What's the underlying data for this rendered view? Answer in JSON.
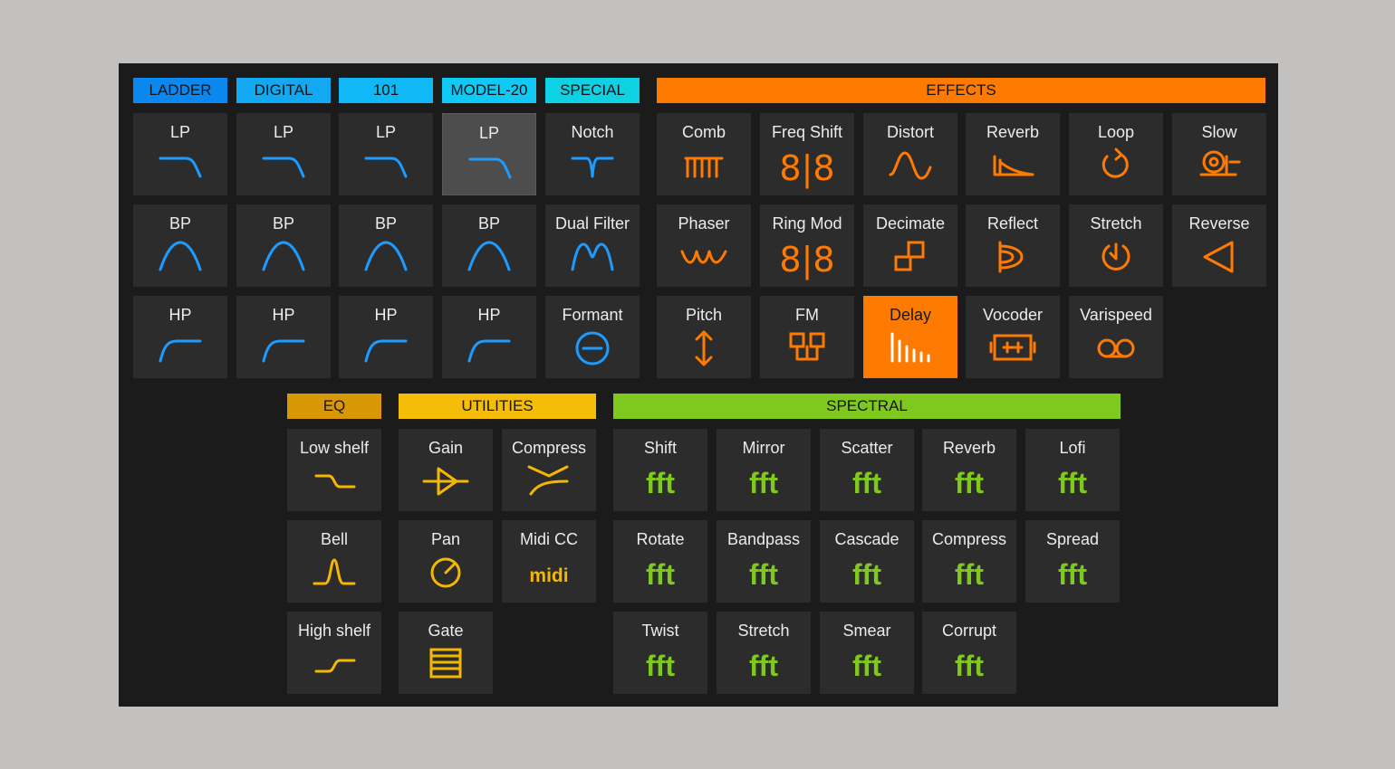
{
  "colors": {
    "panel": "#1b1b1b",
    "tile": "#2c2c2c",
    "tile_selected": "#4d4d4d",
    "tile_active": "#ff7a00",
    "blue_icon": "#1e9bff",
    "orange_icon": "#ff7a00",
    "yellow_icon": "#f5b800",
    "green_icon": "#7fc81e",
    "ladder": "#0a88f0",
    "digital": "#12a8f2",
    "model101": "#10b9f5",
    "model20": "#11c9f5",
    "special": "#0ed2e3",
    "effects": "#ff7a00",
    "eq": "#d89806",
    "utilities": "#f5bd07",
    "spectral": "#7fc81e"
  },
  "headers": {
    "ladder": "LADDER",
    "digital": "DIGITAL",
    "m101": "101",
    "model20": "MODEL-20",
    "special": "SPECIAL",
    "effects": "EFFECTS",
    "eq": "EQ",
    "utilities": "UTILITIES",
    "spectral": "SPECTRAL"
  },
  "filters": [
    {
      "label": "LP",
      "icon": "lowpass-filter-icon"
    },
    {
      "label": "LP",
      "icon": "lowpass-filter-icon"
    },
    {
      "label": "LP",
      "icon": "lowpass-filter-icon"
    },
    {
      "label": "LP",
      "icon": "lowpass-filter-icon",
      "selected": true
    },
    {
      "label": "Notch",
      "icon": "notch-filter-icon"
    },
    {
      "label": "BP",
      "icon": "bandpass-filter-icon"
    },
    {
      "label": "BP",
      "icon": "bandpass-filter-icon"
    },
    {
      "label": "BP",
      "icon": "bandpass-filter-icon"
    },
    {
      "label": "BP",
      "icon": "bandpass-filter-icon"
    },
    {
      "label": "Dual Filter",
      "icon": "dual-filter-icon"
    },
    {
      "label": "HP",
      "icon": "highpass-filter-icon"
    },
    {
      "label": "HP",
      "icon": "highpass-filter-icon"
    },
    {
      "label": "HP",
      "icon": "highpass-filter-icon"
    },
    {
      "label": "HP",
      "icon": "highpass-filter-icon"
    },
    {
      "label": "Formant",
      "icon": "formant-icon"
    }
  ],
  "effects": [
    {
      "label": "Comb",
      "icon": "comb-icon"
    },
    {
      "label": "Freq Shift",
      "icon": "freq-shift-icon"
    },
    {
      "label": "Distort",
      "icon": "distort-icon"
    },
    {
      "label": "Reverb",
      "icon": "reverb-icon"
    },
    {
      "label": "Loop",
      "icon": "loop-icon"
    },
    {
      "label": "Slow",
      "icon": "snail-icon"
    },
    {
      "label": "Phaser",
      "icon": "phaser-icon"
    },
    {
      "label": "Ring Mod",
      "icon": "ring-mod-icon"
    },
    {
      "label": "Decimate",
      "icon": "decimate-icon"
    },
    {
      "label": "Reflect",
      "icon": "reflect-icon"
    },
    {
      "label": "Stretch",
      "icon": "stretch-icon"
    },
    {
      "label": "Reverse",
      "icon": "reverse-icon"
    },
    {
      "label": "Pitch",
      "icon": "pitch-icon"
    },
    {
      "label": "FM",
      "icon": "fm-icon"
    },
    {
      "label": "Delay",
      "icon": "delay-icon",
      "active": true
    },
    {
      "label": "Vocoder",
      "icon": "vocoder-icon"
    },
    {
      "label": "Varispeed",
      "icon": "tape-icon"
    }
  ],
  "eq": [
    {
      "label": "Low shelf",
      "icon": "low-shelf-icon"
    },
    {
      "label": "Bell",
      "icon": "bell-icon"
    },
    {
      "label": "High shelf",
      "icon": "high-shelf-icon"
    }
  ],
  "utilities": [
    {
      "label": "Gain",
      "icon": "gain-icon"
    },
    {
      "label": "Compress",
      "icon": "compress-icon"
    },
    {
      "label": "Pan",
      "icon": "pan-knob-icon"
    },
    {
      "label": "Midi CC",
      "icon": "midi-icon",
      "glyph": "midi"
    },
    {
      "label": "Gate",
      "icon": "gate-icon"
    }
  ],
  "spectral": [
    {
      "label": "Shift",
      "glyph": "fft"
    },
    {
      "label": "Mirror",
      "glyph": "fft"
    },
    {
      "label": "Scatter",
      "glyph": "fft"
    },
    {
      "label": "Reverb",
      "glyph": "fft"
    },
    {
      "label": "Lofi",
      "glyph": "fft"
    },
    {
      "label": "Rotate",
      "glyph": "fft"
    },
    {
      "label": "Bandpass",
      "glyph": "fft"
    },
    {
      "label": "Cascade",
      "glyph": "fft"
    },
    {
      "label": "Compress",
      "glyph": "fft"
    },
    {
      "label": "Spread",
      "glyph": "fft"
    },
    {
      "label": "Twist",
      "glyph": "fft"
    },
    {
      "label": "Stretch",
      "glyph": "fft"
    },
    {
      "label": "Smear",
      "glyph": "fft"
    },
    {
      "label": "Corrupt",
      "glyph": "fft"
    }
  ]
}
